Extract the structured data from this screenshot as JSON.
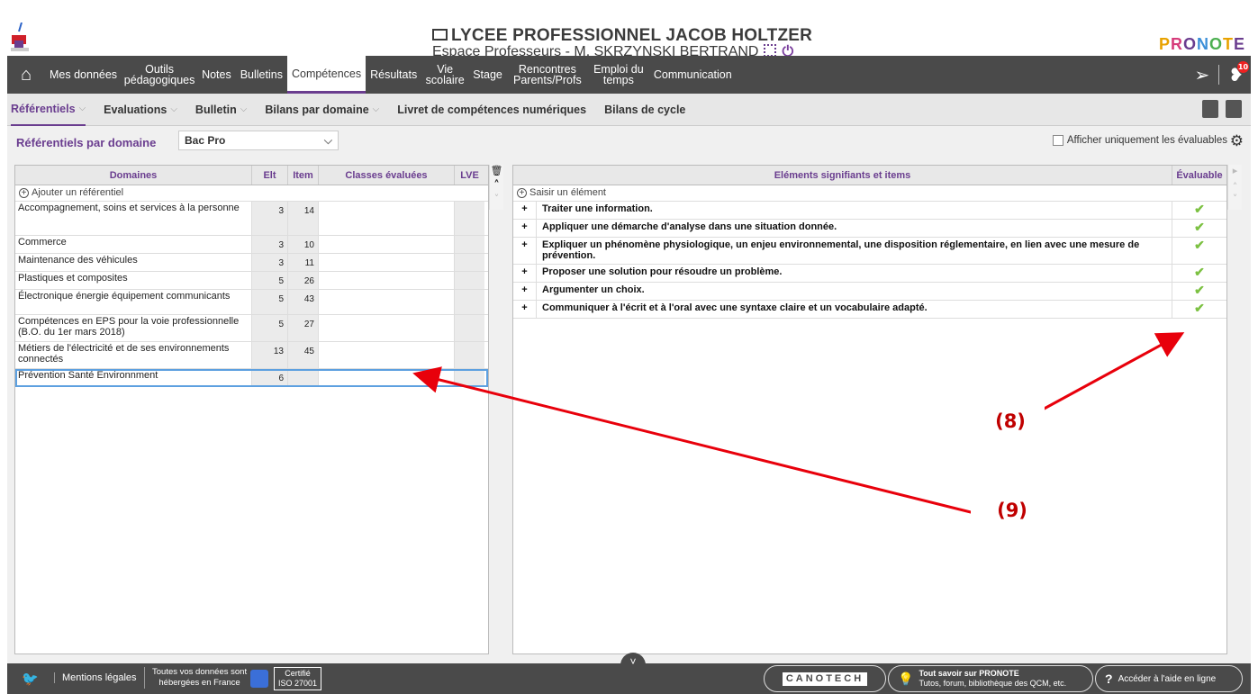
{
  "header": {
    "school": "LYCEE PROFESSIONNEL JACOB HOLTZER",
    "space": "Espace Professeurs - M. SKRZYNSKI BERTRAND",
    "brand": "PRONOTE",
    "notif_count": "10"
  },
  "nav": {
    "items": [
      "Mes données",
      "Outils pédagogiques",
      "Notes",
      "Bulletins",
      "Compétences",
      "Résultats",
      "Vie scolaire",
      "Stage",
      "Rencontres Parents/Profs",
      "Emploi du temps",
      "Communication"
    ],
    "active": "Compétences"
  },
  "subnav": {
    "items": [
      "Référentiels",
      "Evaluations",
      "Bulletin",
      "Bilans par domaine",
      "Livret de compétences numériques",
      "Bilans de cycle"
    ]
  },
  "filter": {
    "label": "Référentiels par domaine",
    "select_value": "Bac Pro",
    "checkbox_label": "Afficher uniquement les évaluables"
  },
  "left_table": {
    "headers": [
      "Domaines",
      "Elt",
      "Item",
      "Classes évaluées",
      "LVE"
    ],
    "add_label": "Ajouter un référentiel",
    "rows": [
      {
        "domain": "Accompagnement, soins et services à la personne",
        "elt": "3",
        "item": "14"
      },
      {
        "domain": "Commerce",
        "elt": "3",
        "item": "10"
      },
      {
        "domain": "Maintenance des véhicules",
        "elt": "3",
        "item": "11"
      },
      {
        "domain": "Plastiques et composites",
        "elt": "5",
        "item": "26"
      },
      {
        "domain": "Électronique énergie équipement communicants",
        "elt": "5",
        "item": "43"
      },
      {
        "domain": "Compétences en EPS pour la voie professionnelle (B.O. du 1er mars 2018)",
        "elt": "5",
        "item": "27"
      },
      {
        "domain": "Métiers de l'électricité et de ses environnements connectés",
        "elt": "13",
        "item": "45"
      },
      {
        "domain": "Prévention Santé Environnment",
        "elt": "6",
        "item": ""
      }
    ]
  },
  "right_table": {
    "headers": [
      "Eléments signifiants et items",
      "Évaluable"
    ],
    "add_label": "Saisir un élément",
    "rows": [
      "Traiter une information.",
      "Appliquer une démarche d'analyse dans une situation donnée.",
      "Expliquer un phénomène physiologique, un enjeu environnemental, une disposition réglementaire, en lien avec une mesure de prévention.",
      "Proposer une solution pour résoudre un problème.",
      "Argumenter un choix.",
      "Communiquer à l'écrit et à l'oral avec une syntaxe claire et un vocabulaire adapté."
    ]
  },
  "annotations": {
    "a8": "(8)",
    "a9": "(9)",
    "color": "#e8000b"
  },
  "footer": {
    "legal": "Mentions légales",
    "hosted_1": "Toutes vos données sont",
    "hosted_2": "hébergées en France",
    "iso_1": "Certifié",
    "iso_2": "ISO 27001",
    "canotech": "CANOTECH",
    "tout_1": "Tout savoir sur PRONOTE",
    "tout_2": "Tutos, forum, bibliothèque des QCM, etc.",
    "aide": "Accéder à l'aide en ligne"
  }
}
